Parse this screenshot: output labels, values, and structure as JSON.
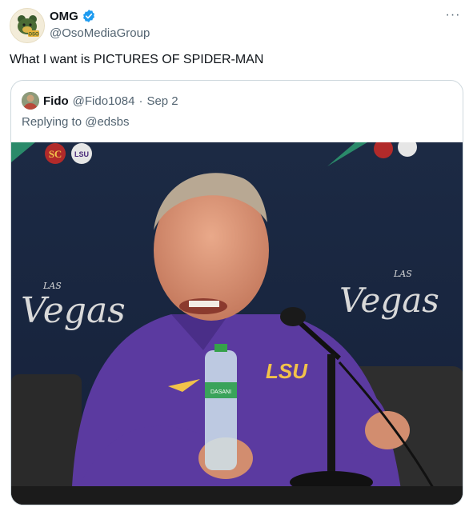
{
  "author": {
    "display_name": "OMG",
    "handle": "@OsoMediaGroup",
    "avatar_icon": "bear-logo-icon",
    "verified_color": "#1d9bf0"
  },
  "more_label": "···",
  "tweet": {
    "text": "What I want is PICTURES OF SPIDER-MAN"
  },
  "quote": {
    "display_name": "Fido",
    "handle": "@Fido1084",
    "separator": "·",
    "date": "Sep 2",
    "replying_to": "Replying to @edsbs",
    "media": {
      "backdrop_text_left": "Vegas",
      "backdrop_text_right": "Vegas",
      "backdrop_small": "LAS",
      "logo_left": "LSU",
      "shirt_logo": "LSU",
      "bottle_label": "DASANI"
    }
  }
}
